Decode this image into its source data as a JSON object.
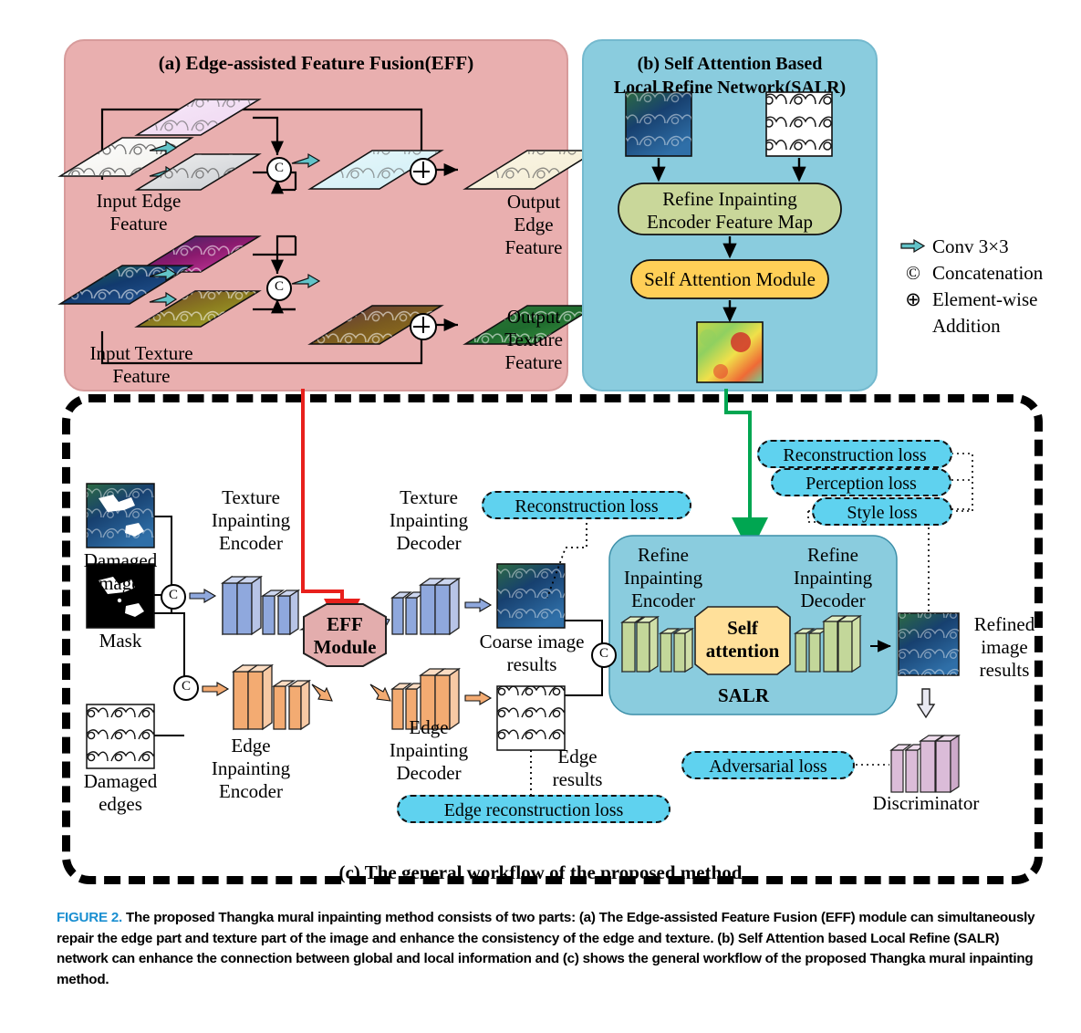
{
  "figure": {
    "label": "FIGURE 2.",
    "caption": "The proposed Thangka mural inpainting method consists of two parts: (a) The Edge-assisted Feature Fusion (EFF) module can simultaneously repair the edge part and texture part of the image and enhance the consistency of the edge and texture. (b) Self Attention based Local Refine (SALR) network can enhance the connection between global and local information and (c) shows the general workflow of the proposed Thangka mural inpainting method."
  },
  "panel_a": {
    "title": "(a) Edge-assisted Feature Fusion(EFF)",
    "background_color": "#e9afaf",
    "labels": {
      "input_edge": "Input Edge\nFeature",
      "input_edge_l1": "Input Edge",
      "input_edge_l2": "Feature",
      "input_texture_l1": "Input Texture",
      "input_texture_l2": "Feature",
      "output_edge_l1": "Output",
      "output_edge_l2": "Edge",
      "output_edge_l3": "Feature",
      "output_texture_l1": "Output",
      "output_texture_l2": "Texture",
      "output_texture_l3": "Feature"
    },
    "operators": {
      "concat": "C",
      "addition": "+"
    }
  },
  "panel_b": {
    "title_line1": "(b) Self Attention Based",
    "title_line2": "Local  Refine Network(SALR)",
    "background_color": "#8accde",
    "blocks": [
      {
        "name": "refine-feature-map",
        "line1": "Refine Inpainting",
        "line2": "Encoder Feature Map",
        "color": "#c9d79a"
      },
      {
        "name": "self-attention-module",
        "line1": "Self Attention Module",
        "color": "#ffcf57"
      }
    ]
  },
  "legend": {
    "items": [
      {
        "icon": "conv-arrow-icon",
        "label": "Conv 3×3"
      },
      {
        "icon": "concatenation-icon",
        "glyph": "©",
        "label": "Concatenation"
      },
      {
        "icon": "element-wise-addition-icon",
        "glyph": "⊕",
        "label": "Element-wise",
        "label2": "Addition"
      }
    ]
  },
  "panel_c": {
    "title": "(c) The general workflow of the proposed method",
    "inputs": [
      {
        "name": "damaged-images",
        "line1": "Damaged",
        "line2": "images"
      },
      {
        "name": "mask",
        "line1": "Mask"
      },
      {
        "name": "damaged-edges",
        "line1": "Damaged",
        "line2": "edges"
      }
    ],
    "stages": [
      {
        "name": "texture-inpainting-encoder",
        "line1": "Texture",
        "line2": "Inpainting",
        "line3": "Encoder",
        "color": "#8fa8dd"
      },
      {
        "name": "edge-inpainting-encoder",
        "line1": "Edge",
        "line2": "Inpainting",
        "line3": "Encoder",
        "color": "#f3ab72"
      },
      {
        "name": "eff-module",
        "line1": "EFF",
        "line2": "Module",
        "color": "#e3adad"
      },
      {
        "name": "texture-inpainting-decoder",
        "line1": "Texture",
        "line2": "Inpainting",
        "line3": "Decoder",
        "color": "#8fa8dd"
      },
      {
        "name": "edge-inpainting-decoder",
        "line1": "Edge",
        "line2": "Inpainting",
        "line3": "Decoder",
        "color": "#f3ab72"
      }
    ],
    "results": [
      {
        "name": "coarse-image-results",
        "line1": "Coarse image",
        "line2": "results"
      },
      {
        "name": "edge-results",
        "line1": "Edge",
        "line2": "results"
      },
      {
        "name": "refined-image-results",
        "line1": "Refined",
        "line2": "image",
        "line3": "results"
      }
    ],
    "salr": {
      "name": "salr-box",
      "title": "SALR",
      "encoder_l1": "Refine",
      "encoder_l2": "Inpainting",
      "encoder_l3": "Encoder",
      "decoder_l1": "Refine",
      "decoder_l2": "Inpainting",
      "decoder_l3": "Decoder",
      "attention_l1": "Self",
      "attention_l2": "attention",
      "background_color": "#8accde",
      "attention_color": "#ffe09a"
    },
    "losses": [
      {
        "name": "reconstruction-loss-coarse",
        "label": "Reconstruction  loss"
      },
      {
        "name": "edge-reconstruction-loss",
        "label": "Edge reconstruction  loss"
      },
      {
        "name": "reconstruction-loss-refine",
        "label": "Reconstruction  loss"
      },
      {
        "name": "perception-loss",
        "label": "Perception loss"
      },
      {
        "name": "style-loss",
        "label": "Style loss"
      },
      {
        "name": "adversarial-loss",
        "label": "Adversarial loss"
      }
    ],
    "discriminator": {
      "name": "discriminator",
      "label": "Discriminator",
      "color": "#dbbcd8"
    },
    "operators": {
      "concat": "C"
    }
  },
  "colors": {
    "panel_a_bg": "#e9afaf",
    "panel_b_bg": "#8accde",
    "loss_pill": "#5fd2ef",
    "conv_arrow": "#62c3c8",
    "eff_arrow": "#e8201c",
    "salr_arrow": "#00a651",
    "caption_label": "#1a8fd1"
  }
}
